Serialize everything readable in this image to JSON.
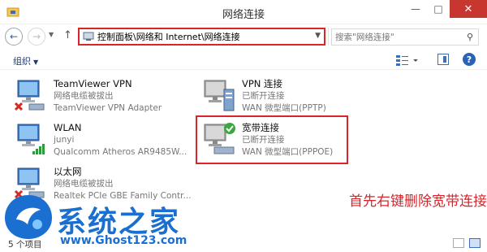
{
  "window": {
    "title": "网络连接"
  },
  "nav": {
    "breadcrumb": "控制面板\\网络和 Internet\\网络连接",
    "search_placeholder": "搜索\"网络连接\""
  },
  "toolbar": {
    "organize_label": "组织"
  },
  "connections": [
    {
      "name": "TeamViewer VPN",
      "status": "网络电缆被拔出",
      "device": "TeamViewer VPN Adapter"
    },
    {
      "name": "VPN 连接",
      "status": "已断开连接",
      "device": "WAN 微型端口(PPTP)"
    },
    {
      "name": "WLAN",
      "status": "junyi",
      "device": "Qualcomm Atheros AR9485W..."
    },
    {
      "name": "宽带连接",
      "status": "已断开连接",
      "device": "WAN 微型端口(PPPOE)"
    },
    {
      "name": "以太网",
      "status": "网络电缆被拔出",
      "device": "Realtek PCIe GBE Family Contr..."
    }
  ],
  "annotation": {
    "text": "首先右键删除宽带连接"
  },
  "watermark": {
    "title": "系统之家",
    "url": "www.Ghost123.com"
  },
  "status": {
    "count": "5 个项目"
  },
  "colors": {
    "highlight": "#d9242a",
    "accent": "#1a6fd0"
  }
}
